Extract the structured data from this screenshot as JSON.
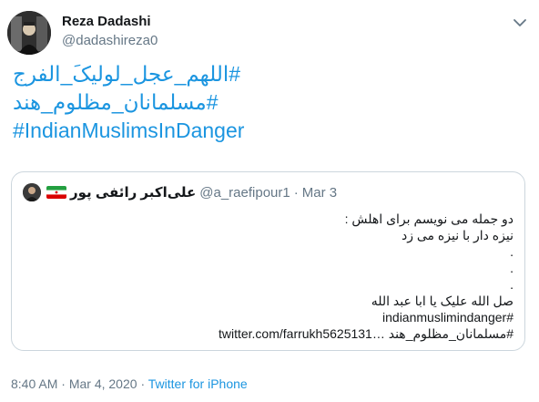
{
  "tweet": {
    "author_name": "Reza Dadashi",
    "author_handle": "@dadashireza0",
    "hashtags": [
      "#اللهم_عجل_لولیکَ_الفرج",
      "#مسلمانان_مظلوم_هند",
      "#IndianMuslimsInDanger"
    ],
    "time": "8:40 AM",
    "separator": "·",
    "date": "Mar 4, 2020",
    "source": "Twitter for iPhone"
  },
  "quoted": {
    "author_name": "علی‌اکبر رائفی پور",
    "author_handle": "@a_raefipour1",
    "separator": "·",
    "date": "Mar 3",
    "lines": [
      "دو جمله می نویسم برای اهلش :",
      "نیزه دار با نیزه می زد",
      ".",
      ".",
      ".",
      "صل الله علیک یا ابا عبد الله",
      "#indianmuslimindanger",
      "#مسلمانان_مظلوم_هند …twitter.com/farrukh5625131"
    ]
  },
  "colors": {
    "link": "#1b95e0",
    "text": "#14171a",
    "muted": "#657786",
    "border": "#ccd6dd"
  },
  "icons": {
    "caret": "chevron-down-icon",
    "flag": "iran-flag-icon"
  }
}
